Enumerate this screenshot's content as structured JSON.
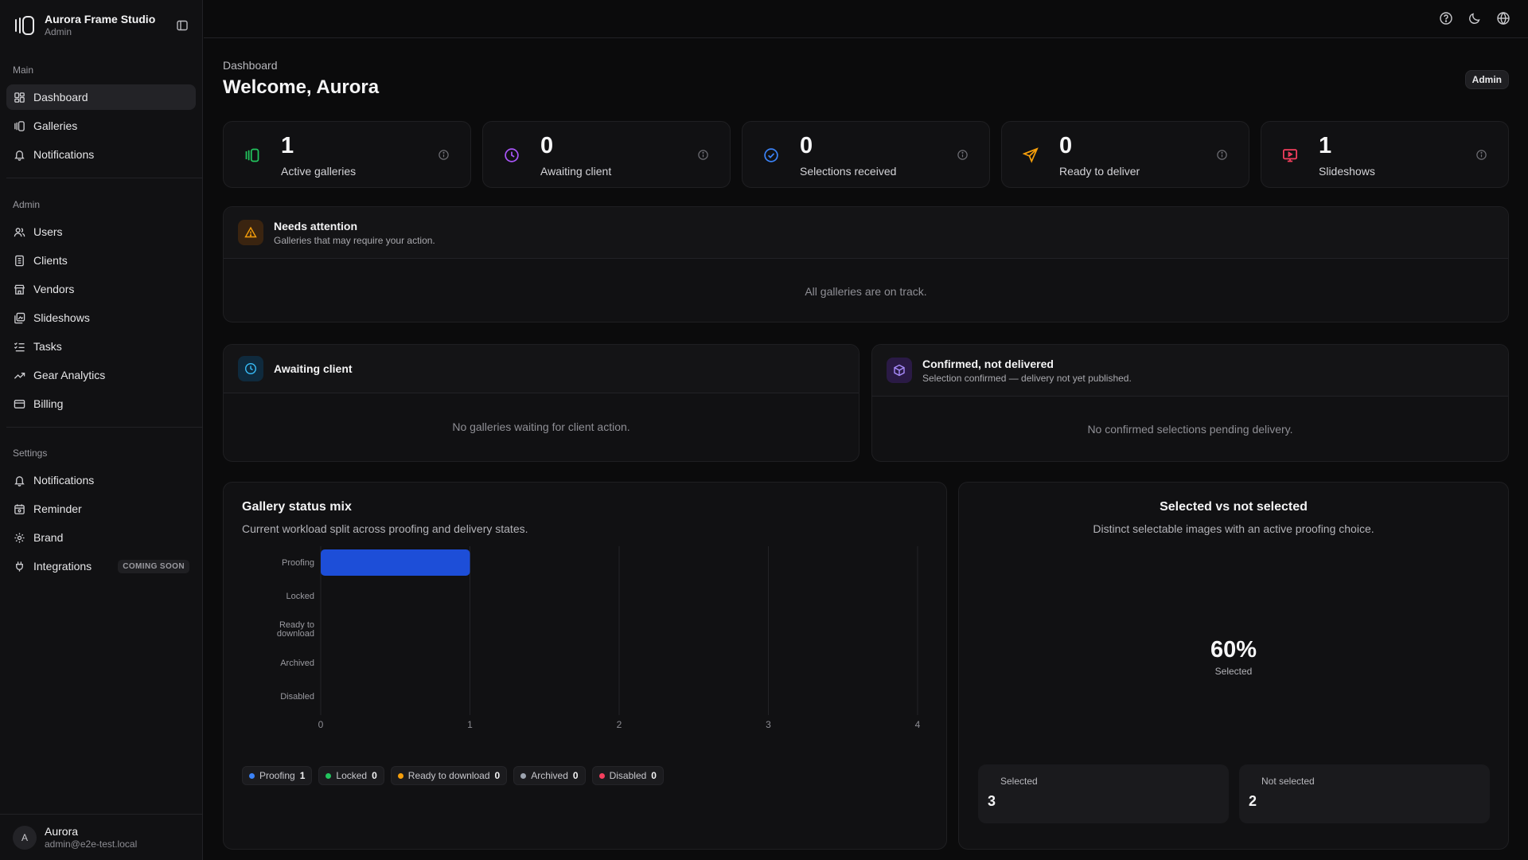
{
  "app": {
    "name": "Aurora Frame Studio",
    "role": "Admin",
    "logo_icon": "logo-icon"
  },
  "sidebar": {
    "sections": [
      {
        "heading": "Main",
        "items": [
          {
            "label": "Dashboard",
            "icon": "dashboard-icon",
            "active": true
          },
          {
            "label": "Galleries",
            "icon": "galleries-icon"
          },
          {
            "label": "Notifications",
            "icon": "bell-icon"
          }
        ]
      },
      {
        "heading": "Admin",
        "items": [
          {
            "label": "Users",
            "icon": "users-icon"
          },
          {
            "label": "Clients",
            "icon": "clients-icon"
          },
          {
            "label": "Vendors",
            "icon": "store-icon"
          },
          {
            "label": "Slideshows",
            "icon": "slideshows-icon"
          },
          {
            "label": "Tasks",
            "icon": "tasks-icon"
          },
          {
            "label": "Gear Analytics",
            "icon": "trend-icon"
          },
          {
            "label": "Billing",
            "icon": "card-icon"
          }
        ]
      },
      {
        "heading": "Settings",
        "items": [
          {
            "label": "Notifications",
            "icon": "bell-icon"
          },
          {
            "label": "Reminder",
            "icon": "calendar-icon"
          },
          {
            "label": "Brand",
            "icon": "gear-icon"
          },
          {
            "label": "Integrations",
            "icon": "plug-icon",
            "badge": "COMING SOON"
          }
        ]
      }
    ]
  },
  "user": {
    "initial": "A",
    "name": "Aurora",
    "email": "admin@e2e-test.local"
  },
  "topbar": {
    "icons": [
      "help-icon",
      "moon-icon",
      "globe-icon"
    ]
  },
  "header": {
    "breadcrumb": "Dashboard",
    "title": "Welcome, Aurora",
    "role_badge": "Admin"
  },
  "stats": [
    {
      "value": "1",
      "label": "Active galleries",
      "icon": "galleries-icon",
      "color": "#22c55e"
    },
    {
      "value": "0",
      "label": "Awaiting client",
      "icon": "clock-icon",
      "color": "#a855f7"
    },
    {
      "value": "0",
      "label": "Selections received",
      "icon": "check-circle-icon",
      "color": "#3b82f6"
    },
    {
      "value": "0",
      "label": "Ready to deliver",
      "icon": "send-icon",
      "color": "#f59e0b"
    },
    {
      "value": "1",
      "label": "Slideshows",
      "icon": "presentation-icon",
      "color": "#f43f5e"
    }
  ],
  "needs_attention": {
    "title": "Needs attention",
    "subtitle": "Galleries that may require your action.",
    "empty": "All galleries are on track."
  },
  "awaiting_client": {
    "title": "Awaiting client",
    "empty": "No galleries waiting for client action."
  },
  "confirmed": {
    "title": "Confirmed, not delivered",
    "subtitle": "Selection confirmed — delivery not yet published.",
    "empty": "No confirmed selections pending delivery."
  },
  "status_chart": {
    "title": "Gallery status mix",
    "subtitle": "Current workload split across proofing and delivery states."
  },
  "chart_data": [
    {
      "type": "bar",
      "orientation": "horizontal",
      "categories": [
        "Proofing",
        "Locked",
        "Ready to download",
        "Archived",
        "Disabled"
      ],
      "values": [
        1,
        0,
        0,
        0,
        0
      ],
      "colors": [
        "#1d4ed8",
        "#22c55e",
        "#f59e0b",
        "#9ca3af",
        "#f43f5e"
      ],
      "xlim": [
        0,
        4
      ],
      "xticks": [
        0,
        1,
        2,
        3,
        4
      ],
      "legend": [
        {
          "label": "Proofing",
          "count": "1",
          "color": "#3b82f6"
        },
        {
          "label": "Locked",
          "count": "0",
          "color": "#22c55e"
        },
        {
          "label": "Ready to download",
          "count": "0",
          "color": "#f59e0b"
        },
        {
          "label": "Archived",
          "count": "0",
          "color": "#9ca3af"
        },
        {
          "label": "Disabled",
          "count": "0",
          "color": "#f43f5e"
        }
      ],
      "legend_position": "bottom-left",
      "grid": true
    },
    {
      "type": "pie",
      "title": "Selected vs not selected",
      "subtitle": "Distinct selectable images with an active proofing choice.",
      "center_value": "60%",
      "center_label": "Selected",
      "slices": [
        {
          "label": "Selected",
          "value": 3
        },
        {
          "label": "Not selected",
          "value": 2
        }
      ]
    }
  ],
  "selection_summary": [
    {
      "label": "Selected",
      "value": "3"
    },
    {
      "label": "Not selected",
      "value": "2"
    }
  ]
}
